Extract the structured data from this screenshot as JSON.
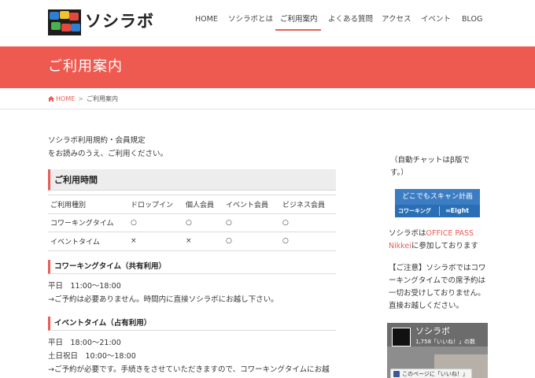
{
  "header": {
    "logo_text": "ソシラボ",
    "nav": [
      "HOME",
      "ソシラボとは",
      "ご利用案内",
      "よくある質問",
      "アクセス",
      "イベント",
      "BLOG"
    ],
    "active_nav": "ご利用案内",
    "accent_color": "#ee5a50"
  },
  "banner": {
    "title": "ご利用案内"
  },
  "breadcrumb": {
    "home": "HOME",
    "separator": ">",
    "current": "ご利用案内"
  },
  "main": {
    "terms_link": "ソシラボ利用規約・会員規定",
    "terms_note": "をお読みのうえ、ご利用ください。",
    "hours_heading": "ご利用時間",
    "table": {
      "headers": [
        "ご利用種別",
        "ドロップイン",
        "個人会員",
        "イベント会員",
        "ビジネス会員"
      ],
      "rows": [
        [
          "コワーキングタイム",
          "○",
          "○",
          "○",
          "○"
        ],
        [
          "イベントタイム",
          "×",
          "×",
          "○",
          "○"
        ]
      ]
    },
    "coworking": {
      "heading": "コワーキングタイム（共有利用）",
      "hours": "平日　11:00〜18:00",
      "note": "→ご予約は必要ありません。時間内に直接ソシラボにお越し下さい。"
    },
    "event": {
      "heading": "イベントタイム（占有利用）",
      "weekday": "平日　18:00〜21:00",
      "weekend": "土日祝日　10:00〜18:00",
      "note": "→ご予約が必要です。手続きをさせていただきますので、コワーキングタイムにお越"
    }
  },
  "sidebar": {
    "chat_line1": "（自動チャットはβ版で",
    "chat_line2": "す。）",
    "scan_banner": {
      "top": "どこでもスキャン計画",
      "left": "コワーキング",
      "right": "∞Eight"
    },
    "officepass_pre": "ソシラボは",
    "officepass_link1": "OFFICE PASS",
    "officepass_link2": "Nikkei",
    "officepass_post": "に参加しております",
    "notice_lines": [
      "【ご注意】ソシラボではコワ",
      "ーキングタイムでの席予約は",
      "一切お受けしておりません。",
      "直接お越しください。"
    ],
    "fb": {
      "name": "ソシラボ",
      "likes": "1,758「いいね！」の数",
      "like_button": "このページに「いいね！」"
    }
  }
}
